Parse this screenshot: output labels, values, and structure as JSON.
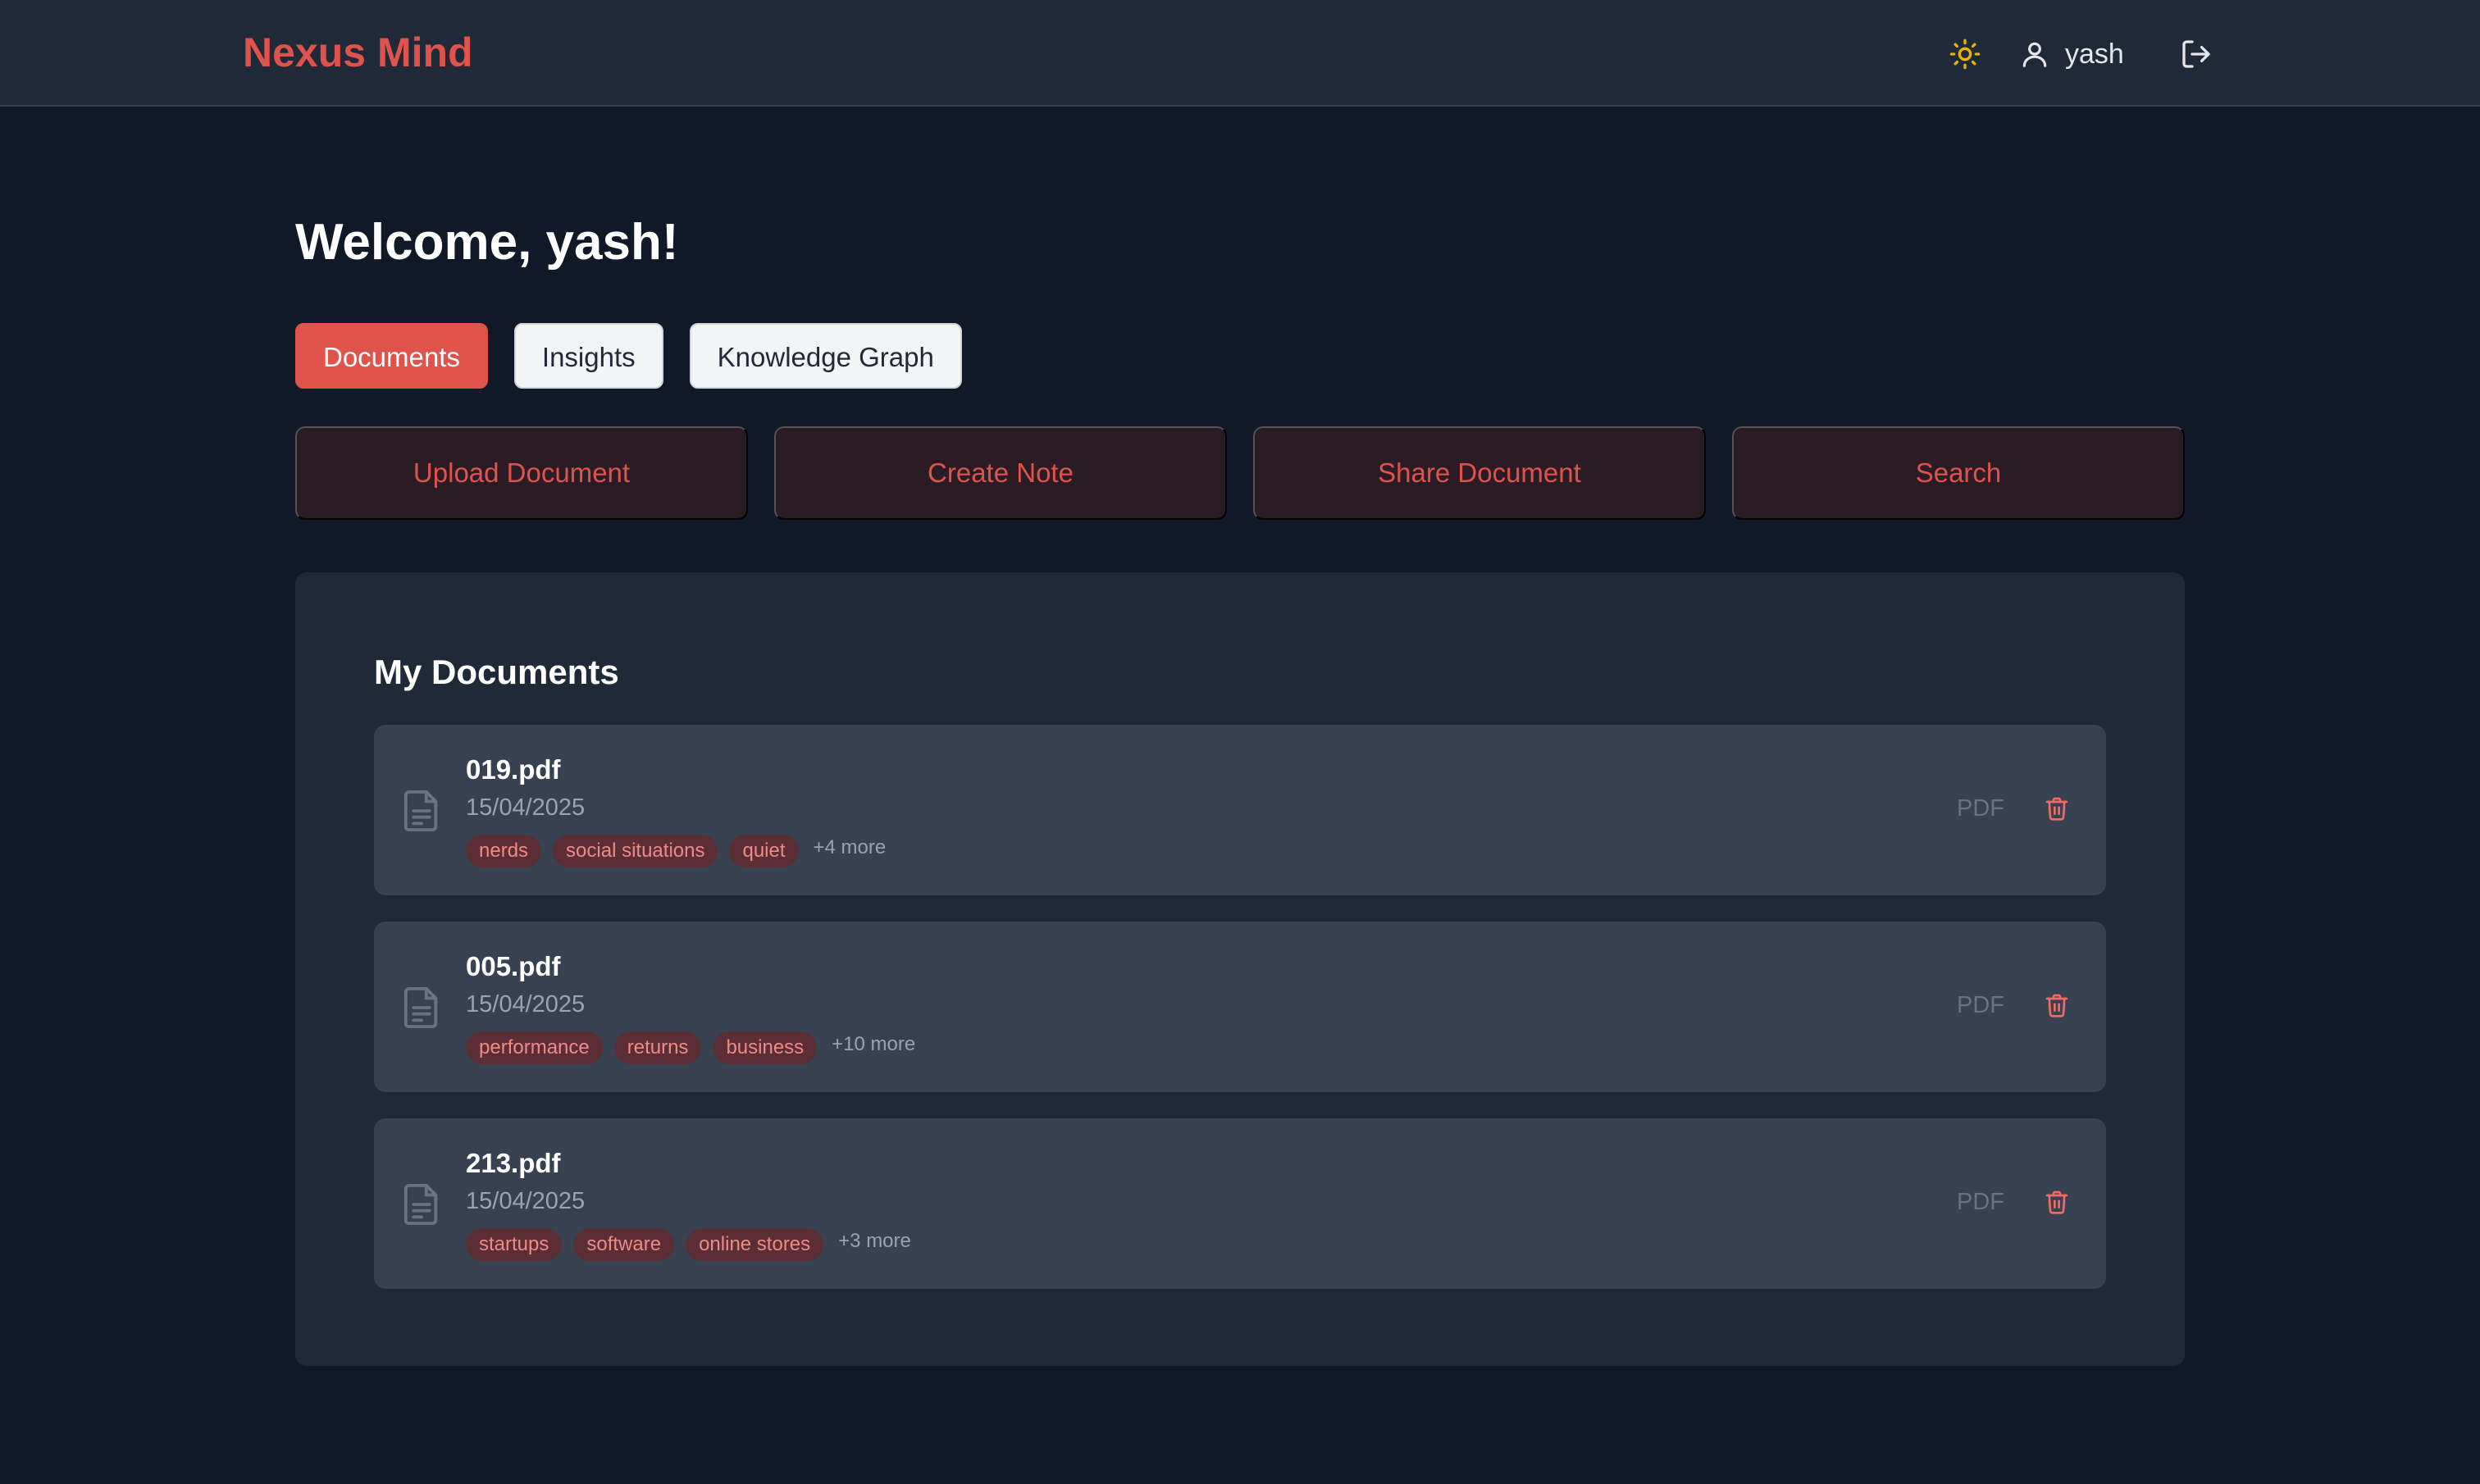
{
  "header": {
    "brand": "Nexus Mind",
    "user_name": "yash",
    "theme_icon": "sun-icon",
    "user_icon": "user-icon",
    "logout_icon": "logout-icon",
    "brand_color": "#e0524c"
  },
  "main": {
    "welcome": "Welcome, yash!",
    "tabs": [
      {
        "label": "Documents",
        "active": true
      },
      {
        "label": "Insights",
        "active": false
      },
      {
        "label": "Knowledge Graph",
        "active": false
      }
    ],
    "actions": [
      {
        "label": "Upload Document"
      },
      {
        "label": "Create Note"
      },
      {
        "label": "Share Document"
      },
      {
        "label": "Search"
      }
    ]
  },
  "documents": {
    "title": "My Documents",
    "items": [
      {
        "name": "019.pdf",
        "date": "15/04/2025",
        "tags": [
          "nerds",
          "social situations",
          "quiet"
        ],
        "more": "+4 more",
        "type": "PDF"
      },
      {
        "name": "005.pdf",
        "date": "15/04/2025",
        "tags": [
          "performance",
          "returns",
          "business"
        ],
        "more": "+10 more",
        "type": "PDF"
      },
      {
        "name": "213.pdf",
        "date": "15/04/2025",
        "tags": [
          "startups",
          "software",
          "online stores"
        ],
        "more": "+3 more",
        "type": "PDF"
      }
    ]
  }
}
